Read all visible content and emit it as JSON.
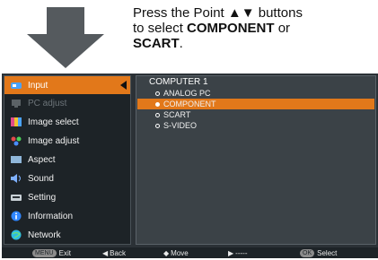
{
  "instruction": {
    "line1": "Press the Point ▲▼ buttons",
    "line2_pre": "to select ",
    "line2_bold": "COMPONENT",
    "line2_post": " or",
    "line3_bold": "SCART",
    "line3_post": "."
  },
  "menu": {
    "items": [
      {
        "label": "Input",
        "icon": "input-icon",
        "color": "#4aa3ff"
      },
      {
        "label": "PC adjust",
        "icon": "pc-adjust-icon",
        "color": "#6c7479"
      },
      {
        "label": "Image select",
        "icon": "image-select-icon",
        "color": "#e04b8a"
      },
      {
        "label": "Image adjust",
        "icon": "image-adjust-icon",
        "color": "#4bd35a"
      },
      {
        "label": "Aspect",
        "icon": "aspect-icon",
        "color": "#8fb6d9"
      },
      {
        "label": "Sound",
        "icon": "sound-icon",
        "color": "#7fb1ff"
      },
      {
        "label": "Setting",
        "icon": "setting-icon",
        "color": "#c9d1d6"
      },
      {
        "label": "Information",
        "icon": "information-icon",
        "color": "#2f86ff"
      },
      {
        "label": "Network",
        "icon": "network-icon",
        "color": "#2dbbe3"
      }
    ]
  },
  "submenu": {
    "title": "COMPUTER 1",
    "options": [
      "ANALOG PC",
      "COMPONENT",
      "SCART",
      "S-VIDEO"
    ],
    "selected": "COMPONENT"
  },
  "bottom_bar": {
    "exit": {
      "key": "MENU",
      "label": "Exit"
    },
    "back": {
      "glyph": "◀",
      "label": "Back"
    },
    "move": {
      "glyph": "◆",
      "label": "Move"
    },
    "next": {
      "glyph": "▶",
      "label": "-----"
    },
    "select": {
      "key": "OK",
      "label": "Select"
    }
  },
  "colors": {
    "accent": "#e2781a",
    "panel": "#2b3136"
  }
}
